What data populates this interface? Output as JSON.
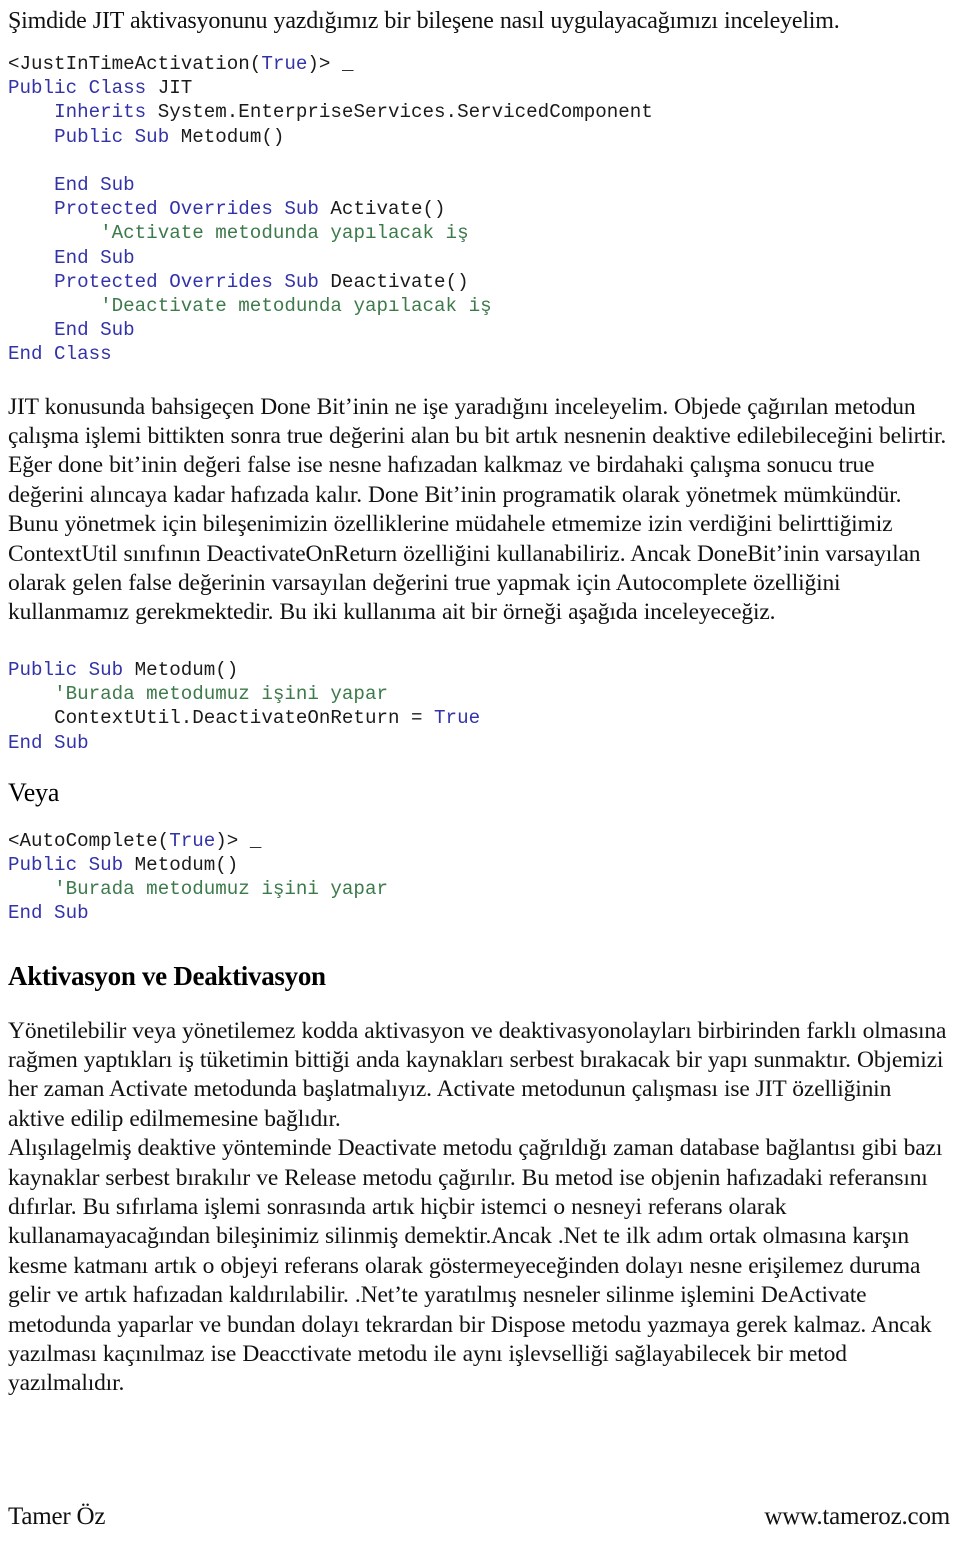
{
  "document": {
    "intro_sentence": "Şimdide JIT aktivasyonunu yazdığımız bir bileşene nasıl uygulayacağımızı inceleyelim.",
    "code_block_1": {
      "name": "jit-class-example",
      "lines": [
        [
          {
            "t": "<JustInTimeActivation(",
            "c": "pl"
          },
          {
            "t": "True",
            "c": "lit"
          },
          {
            "t": ")> ",
            "c": "pl"
          },
          {
            "t": "_",
            "c": "cont"
          }
        ],
        [
          {
            "t": "Public Class ",
            "c": "kw"
          },
          {
            "t": "JIT",
            "c": "pl"
          }
        ],
        [
          {
            "t": "    ",
            "c": "pl"
          },
          {
            "t": "Inherits ",
            "c": "kw"
          },
          {
            "t": "System.EnterpriseServices.ServicedComponent",
            "c": "pl"
          }
        ],
        [
          {
            "t": "    ",
            "c": "pl"
          },
          {
            "t": "Public Sub ",
            "c": "kw"
          },
          {
            "t": "Metodum()",
            "c": "pl"
          }
        ],
        [
          {
            "t": "",
            "c": "pl"
          }
        ],
        [
          {
            "t": "    ",
            "c": "pl"
          },
          {
            "t": "End Sub",
            "c": "kw"
          }
        ],
        [
          {
            "t": "    ",
            "c": "pl"
          },
          {
            "t": "Protected Overrides Sub ",
            "c": "kw"
          },
          {
            "t": "Activate()",
            "c": "pl"
          }
        ],
        [
          {
            "t": "        ",
            "c": "pl"
          },
          {
            "t": "'Activate metodunda yapılacak iş",
            "c": "cm"
          }
        ],
        [
          {
            "t": "    ",
            "c": "pl"
          },
          {
            "t": "End Sub",
            "c": "kw"
          }
        ],
        [
          {
            "t": "    ",
            "c": "pl"
          },
          {
            "t": "Protected Overrides Sub ",
            "c": "kw"
          },
          {
            "t": "Deactivate()",
            "c": "pl"
          }
        ],
        [
          {
            "t": "        ",
            "c": "pl"
          },
          {
            "t": "'Deactivate metodunda yapılacak iş",
            "c": "cm"
          }
        ],
        [
          {
            "t": "    ",
            "c": "pl"
          },
          {
            "t": "End Sub",
            "c": "kw"
          }
        ],
        [
          {
            "t": "End Class",
            "c": "kw"
          }
        ]
      ]
    },
    "paragraph_done_bit": "JIT konusunda bahsigeçen Done Bit’inin ne işe yaradığını inceleyelim. Objede çağırılan metodun çalışma işlemi bittikten sonra true değerini alan bu bit artık nesnenin deaktive edilebileceğini belirtir. Eğer done bit’inin değeri false ise nesne hafızadan kalkmaz ve birdahaki çalışma sonucu true değerini alıncaya kadar hafızada kalır. Done Bit’inin programatik olarak yönetmek mümkündür. Bunu yönetmek için bileşenimizin özelliklerine müdahele etmemize izin verdiğini belirttiğimiz ContextUtil sınıfının DeactivateOnReturn özelliğini kullanabiliriz.  Ancak DoneBit’inin varsayılan olarak gelen false değerinin varsayılan değerini true yapmak için Autocomplete özelliğini kullanmamız gerekmektedir. Bu iki kullanıma ait bir örneği aşağıda inceleyeceğiz.",
    "code_block_2": {
      "name": "deactivateonreturn-example",
      "lines": [
        [
          {
            "t": "Public Sub ",
            "c": "kw"
          },
          {
            "t": "Metodum()",
            "c": "pl"
          }
        ],
        [
          {
            "t": "    ",
            "c": "pl"
          },
          {
            "t": "'Burada metodumuz işini yapar",
            "c": "cm"
          }
        ],
        [
          {
            "t": "    ",
            "c": "pl"
          },
          {
            "t": "ContextUtil.DeactivateOnReturn = ",
            "c": "pl"
          },
          {
            "t": "True",
            "c": "lit"
          }
        ],
        [
          {
            "t": "End Sub",
            "c": "kw"
          }
        ]
      ]
    },
    "veya_label": "Veya",
    "code_block_3": {
      "name": "autocomplete-example",
      "lines": [
        [
          {
            "t": "<AutoComplete(",
            "c": "pl"
          },
          {
            "t": "True",
            "c": "lit"
          },
          {
            "t": ")> ",
            "c": "pl"
          },
          {
            "t": "_",
            "c": "cont"
          }
        ],
        [
          {
            "t": "Public Sub ",
            "c": "kw"
          },
          {
            "t": "Metodum()",
            "c": "pl"
          }
        ],
        [
          {
            "t": "    ",
            "c": "pl"
          },
          {
            "t": "'Burada metodumuz işini yapar",
            "c": "cm"
          }
        ],
        [
          {
            "t": "End Sub",
            "c": "kw"
          }
        ]
      ]
    },
    "section_heading": "Aktivasyon ve Deaktivasyon",
    "paragraph_activation_1": "Yönetilebilir veya yönetilemez kodda aktivasyon ve deaktivasyonolayları birbirinden farklı olmasına rağmen yaptıkları iş tüketimin bittiği anda kaynakları serbest bırakacak bir yapı sunmaktır. Objemizi her zaman Activate metodunda başlatmalıyız. Activate metodunun çalışması ise JIT özelliğinin aktive edilip edilmemesine bağlıdır.",
    "paragraph_activation_2": "Alışılagelmiş deaktive yönteminde Deactivate metodu çağrıldığı zaman database bağlantısı gibi bazı kaynaklar serbest bırakılır ve Release metodu çağırılır. Bu metod ise objenin hafızadaki referansını dıfırlar. Bu sıfırlama işlemi sonrasında artık hiçbir istemci o nesneyi referans olarak kullanamayacağından bileşinimiz silinmiş demektir.Ancak .Net te ilk adım ortak olmasına karşın kesme katmanı artık o objeyi referans olarak göstermeyeceğinden dolayı nesne erişilemez duruma gelir ve artık hafızadan kaldırılabilir. .Net’te yaratılmış nesneler silinme işlemini DeActivate metodunda yaparlar ve bundan dolayı tekrardan bir Dispose metodu yazmaya gerek kalmaz. Ancak yazılması kaçınılmaz ise Deacctivate metodu ile aynı işlevselliği sağlayabilecek bir metod yazılmalıdır."
  },
  "footer": {
    "author": "Tamer Öz",
    "website": "www.tameroz.com"
  },
  "colors": {
    "keyword_blue": "#3333a8",
    "comment_green": "#3c7a4a",
    "text_black": "#111111",
    "page_background": "#ffffff"
  }
}
